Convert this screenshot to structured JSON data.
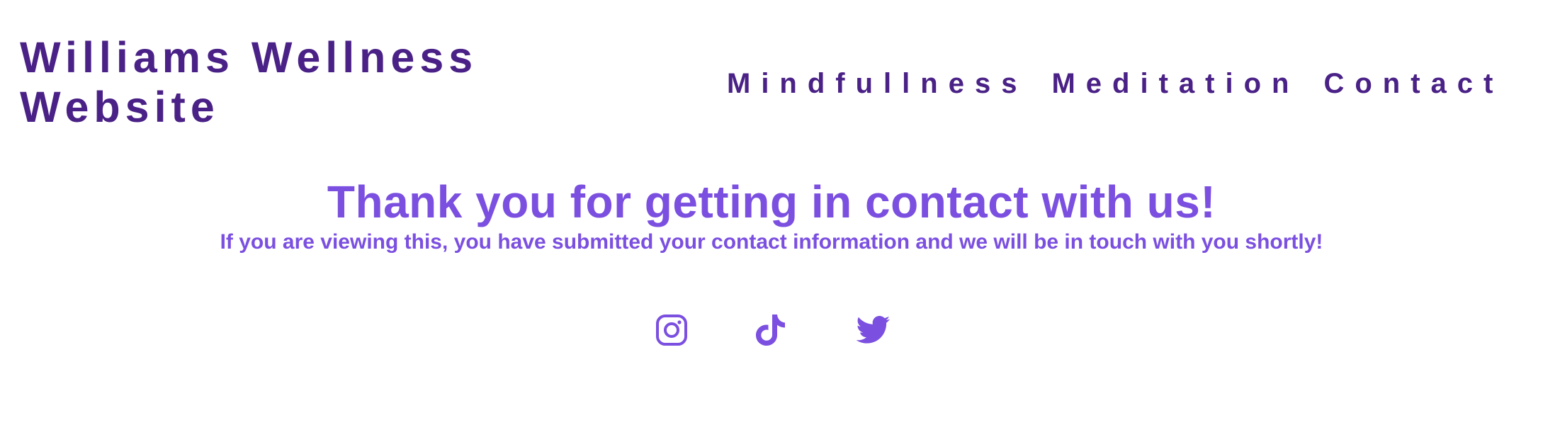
{
  "header": {
    "site_title": "Williams Wellness Website",
    "nav": [
      {
        "label": "Mindfullness"
      },
      {
        "label": "Meditation"
      },
      {
        "label": "Contact"
      }
    ]
  },
  "main": {
    "headline": "Thank you for getting in contact with us!",
    "message": "If you are viewing this, you have submitted your contact information and we will be in touch with you shortly!"
  },
  "social": [
    {
      "icon": "instagram-icon"
    },
    {
      "icon": "tiktok-icon"
    },
    {
      "icon": "twitter-icon"
    }
  ],
  "colors": {
    "brand_dark": "#4a2186",
    "accent": "#7b4fe0",
    "background": "#ffffff"
  }
}
